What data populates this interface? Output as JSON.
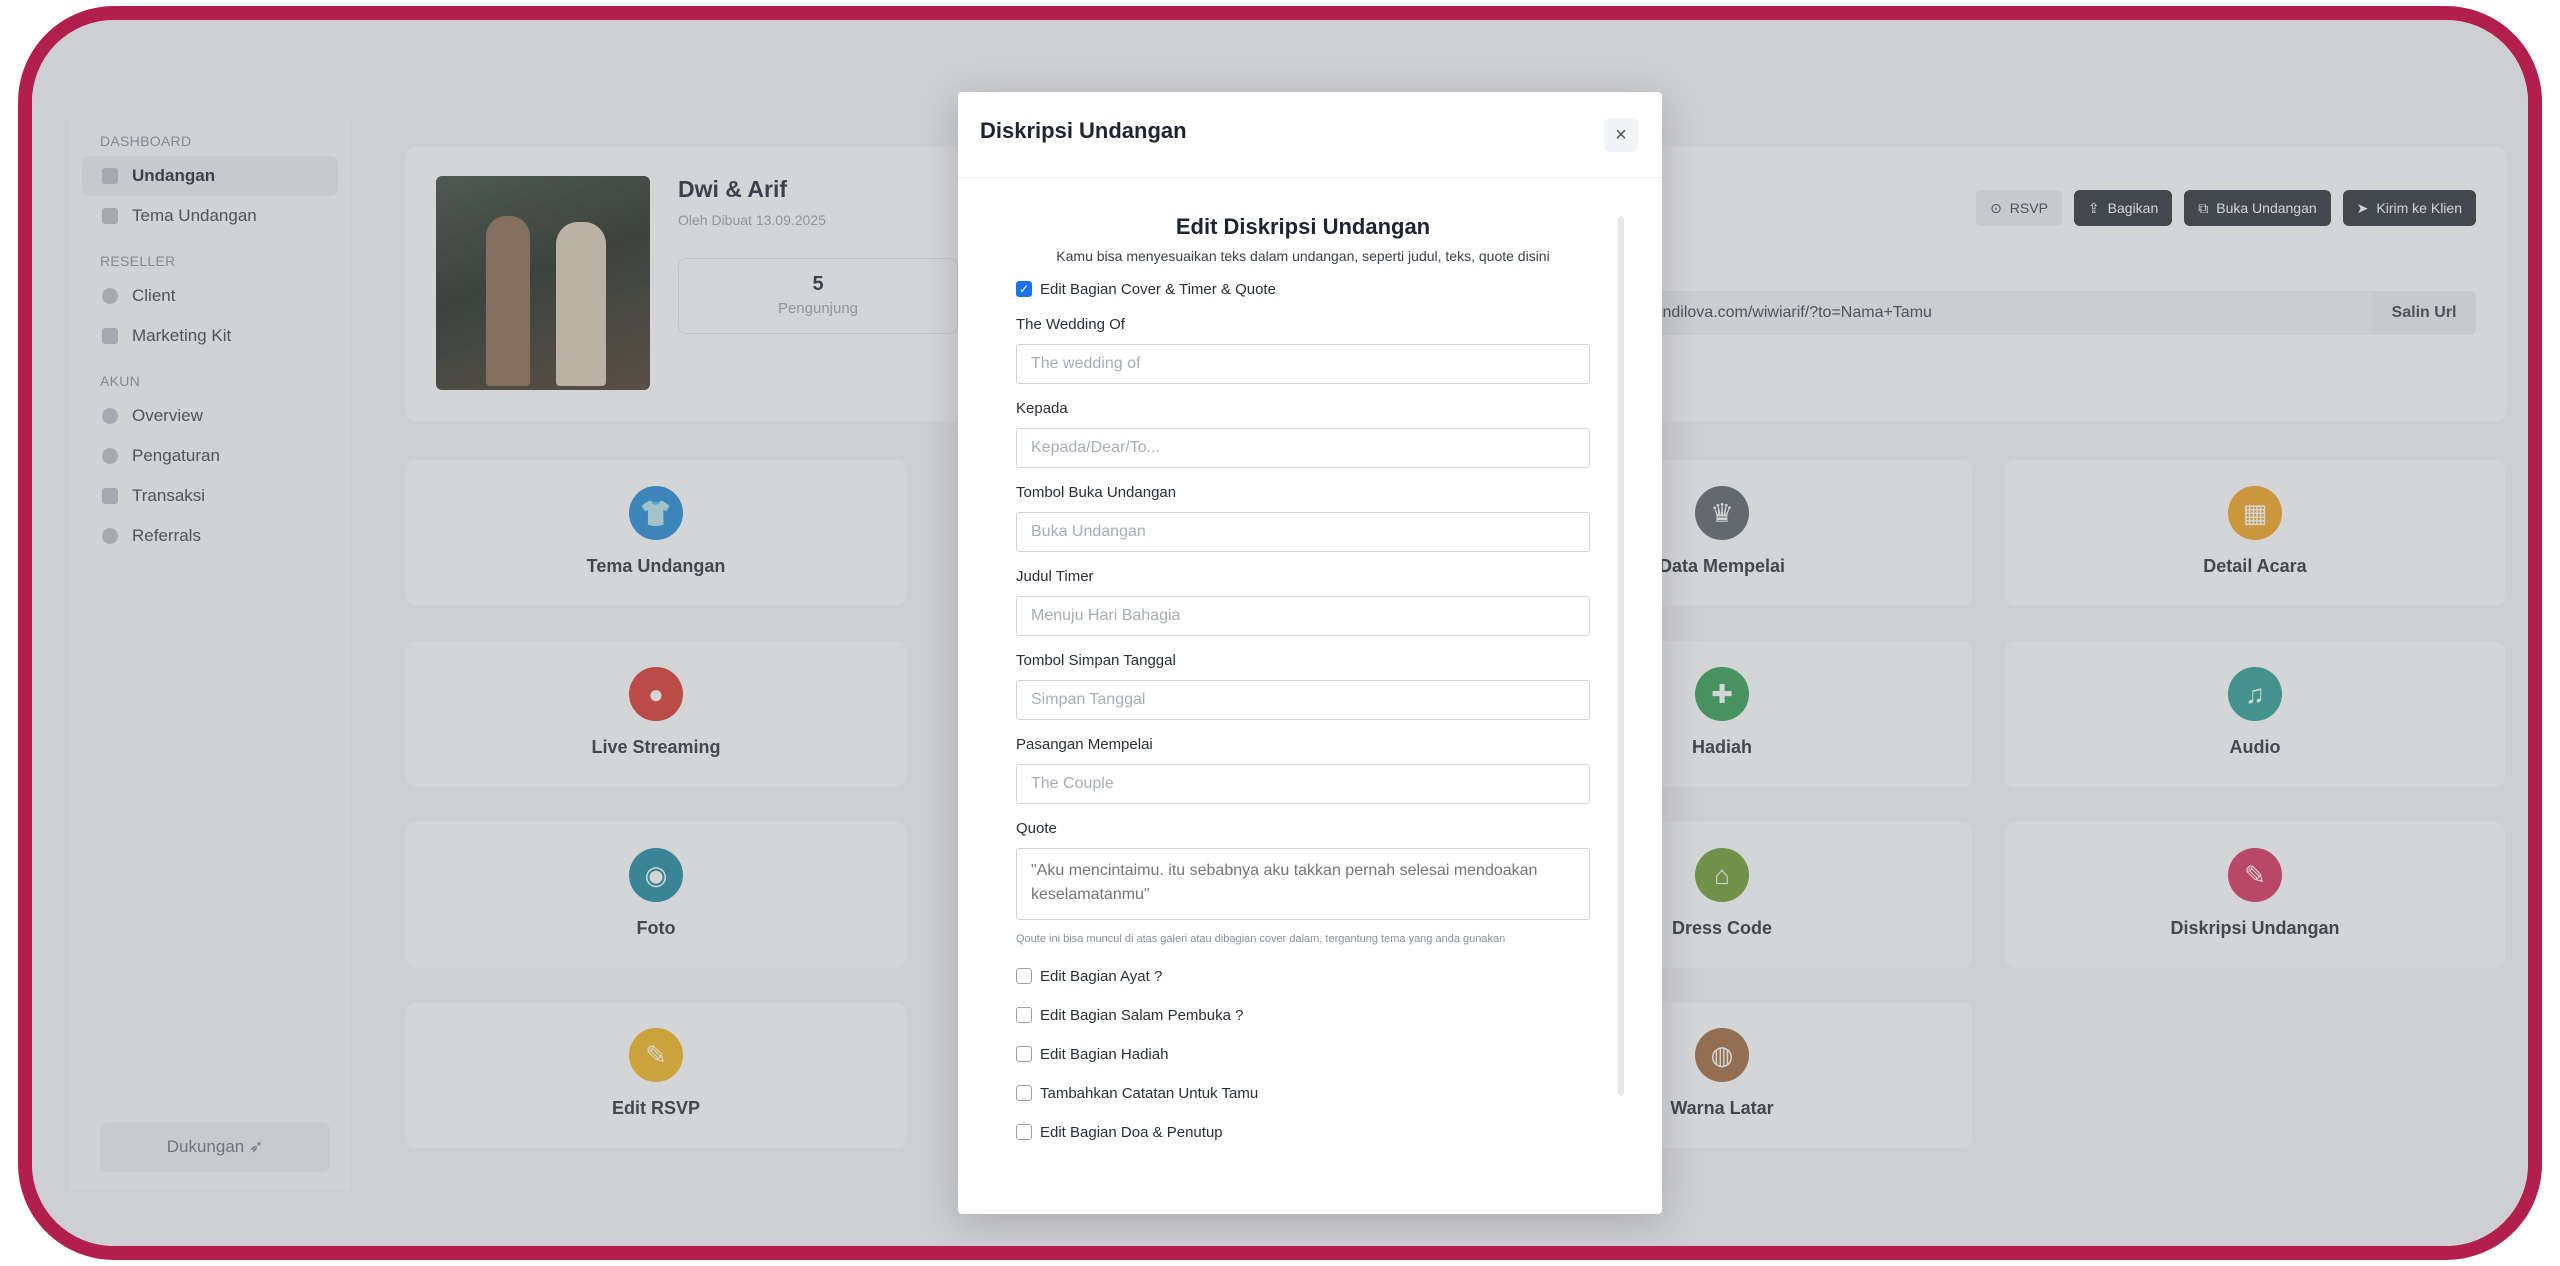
{
  "sidebar": {
    "sections": [
      {
        "title": "DASHBOARD",
        "items": [
          {
            "label": "Undangan",
            "active": true
          },
          {
            "label": "Tema Undangan"
          }
        ]
      },
      {
        "title": "RESELLER",
        "items": [
          {
            "label": "Client"
          },
          {
            "label": "Marketing Kit"
          }
        ]
      },
      {
        "title": "AKUN",
        "items": [
          {
            "label": "Overview"
          },
          {
            "label": "Pengaturan"
          },
          {
            "label": "Transaksi"
          },
          {
            "label": "Referrals"
          }
        ]
      }
    ],
    "support_label": "Dukungan"
  },
  "header": {
    "name": "Dwi & Arif",
    "meta": "Oleh   Dibuat 13.09.2025",
    "stat_value": "5",
    "stat_label": "Pengunjung",
    "buttons": {
      "rsvp": "RSVP",
      "share": "Bagikan",
      "open": "Buka Undangan",
      "send": "Kirim ke Klien"
    },
    "url": "the.gandilova.com/wiwiarif/?to=Nama+Tamu",
    "copy_url": "Salin Url"
  },
  "tiles": [
    {
      "label": "Tema Undangan",
      "color": "#1f8ad6",
      "glyph": "👕"
    },
    {
      "label": "Data Mempelai",
      "color": "#5b5f66",
      "glyph": "♛"
    },
    {
      "label": "Detail Acara",
      "color": "#f2a31b",
      "glyph": "▦"
    },
    {
      "label": "Live Streaming",
      "color": "#d9342b",
      "glyph": "●"
    },
    {
      "label": "Hadiah",
      "color": "#2e9e4f",
      "glyph": "✚"
    },
    {
      "label": "Audio",
      "color": "#2a9d8f",
      "glyph": "♫"
    },
    {
      "label": "Foto",
      "color": "#1b8a9e",
      "glyph": "◉"
    },
    {
      "label": "Dress Code",
      "color": "#6a9b2e",
      "glyph": "⌂"
    },
    {
      "label": "Diskripsi Undangan",
      "color": "#d62e5c",
      "glyph": "✎"
    },
    {
      "label": "Edit RSVP",
      "color": "#f2b51b",
      "glyph": "✎"
    },
    {
      "label": "Warna Latar",
      "color": "#a0683a",
      "glyph": "◍"
    }
  ],
  "modal": {
    "title": "Diskripsi Undangan",
    "close_label": "×",
    "heading": "Edit Diskripsi Undangan",
    "subheading": "Kamu bisa menyesuaikan teks dalam undangan, seperti judul, teks, quote disini",
    "cover_toggle": "Edit Bagian Cover & Timer & Quote",
    "fields": [
      {
        "label": "The Wedding Of",
        "placeholder": "The wedding of"
      },
      {
        "label": "Kepada",
        "placeholder": "Kepada/Dear/To..."
      },
      {
        "label": "Tombol Buka Undangan",
        "placeholder": "Buka Undangan"
      },
      {
        "label": "Judul Timer",
        "placeholder": "Menuju Hari Bahagia"
      },
      {
        "label": "Tombol Simpan Tanggal",
        "placeholder": "Simpan Tanggal"
      },
      {
        "label": "Pasangan Mempelai",
        "placeholder": "The Couple"
      }
    ],
    "quote_label": "Quote",
    "quote_placeholder": "\"Aku mencintaimu. itu sebabnya aku takkan pernah selesai mendoakan keselamatanmu\"",
    "quote_hint": "Qoute ini bisa muncul di atas galeri atau dibagian cover dalam, tergantung tema yang anda gunakan",
    "checkboxes": [
      "Edit Bagian Ayat ?",
      "Edit Bagian Salam Pembuka ?",
      "Edit Bagian Hadiah",
      "Tambahkan Catatan Untuk Tamu",
      "Edit Bagian Doa & Penutup"
    ]
  }
}
